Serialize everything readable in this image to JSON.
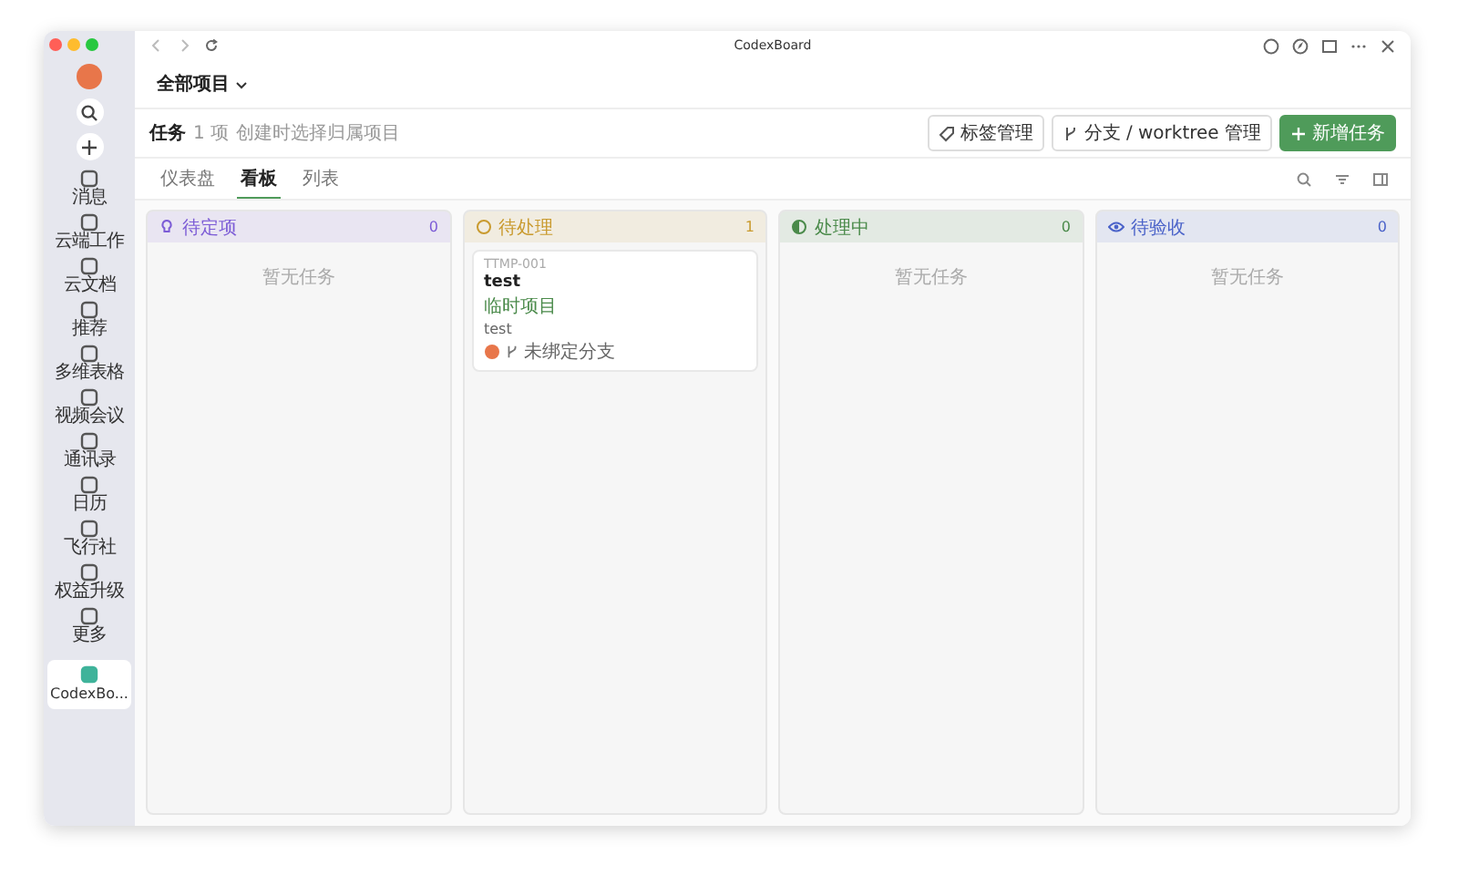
{
  "window": {
    "title": "CodexBoard"
  },
  "sidebar": {
    "items": [
      {
        "label": "消息",
        "selected": false
      },
      {
        "label": "云端工作",
        "selected": false
      },
      {
        "label": "云文档",
        "selected": false
      },
      {
        "label": "推荐",
        "selected": false
      },
      {
        "label": "多维表格",
        "selected": false
      },
      {
        "label": "视频会议",
        "selected": false
      },
      {
        "label": "通讯录",
        "selected": false
      },
      {
        "label": "日历",
        "selected": false
      },
      {
        "label": "飞行社",
        "selected": false
      },
      {
        "label": "权益升级",
        "selected": false
      },
      {
        "label": "更多",
        "selected": false
      },
      {
        "label": "CodexBo...",
        "selected": true
      }
    ]
  },
  "header": {
    "project_selector": "全部项目"
  },
  "toolbar": {
    "title": "任务",
    "count": "1 项",
    "hint": "创建时选择归属项目",
    "buttons": [
      {
        "label": "标签管理",
        "kind": "tag"
      },
      {
        "label": "分支 / worktree 管理",
        "kind": "branch"
      },
      {
        "label": "新增任务",
        "kind": "primary"
      }
    ]
  },
  "tabs": [
    {
      "label": "仪表盘",
      "selected": false
    },
    {
      "label": "看板",
      "selected": true
    },
    {
      "label": "列表",
      "selected": false
    }
  ],
  "columns": [
    {
      "title": "待定项",
      "count": "0",
      "kind": "pending",
      "color": "#7c5cd6",
      "empty_text": "暂无任务"
    },
    {
      "title": "待处理",
      "count": "1",
      "kind": "todo",
      "color": "#c99a2e",
      "cards": [
        {
          "id": "TTMP-001",
          "title": "test",
          "project": "临时项目",
          "description": "test",
          "branch": "未绑定分支"
        }
      ]
    },
    {
      "title": "处理中",
      "count": "0",
      "kind": "doing",
      "color": "#4a8a4a",
      "empty_text": "暂无任务"
    },
    {
      "title": "待验收",
      "count": "0",
      "kind": "review",
      "color": "#4b63c9",
      "empty_text": "暂无任务"
    }
  ]
}
